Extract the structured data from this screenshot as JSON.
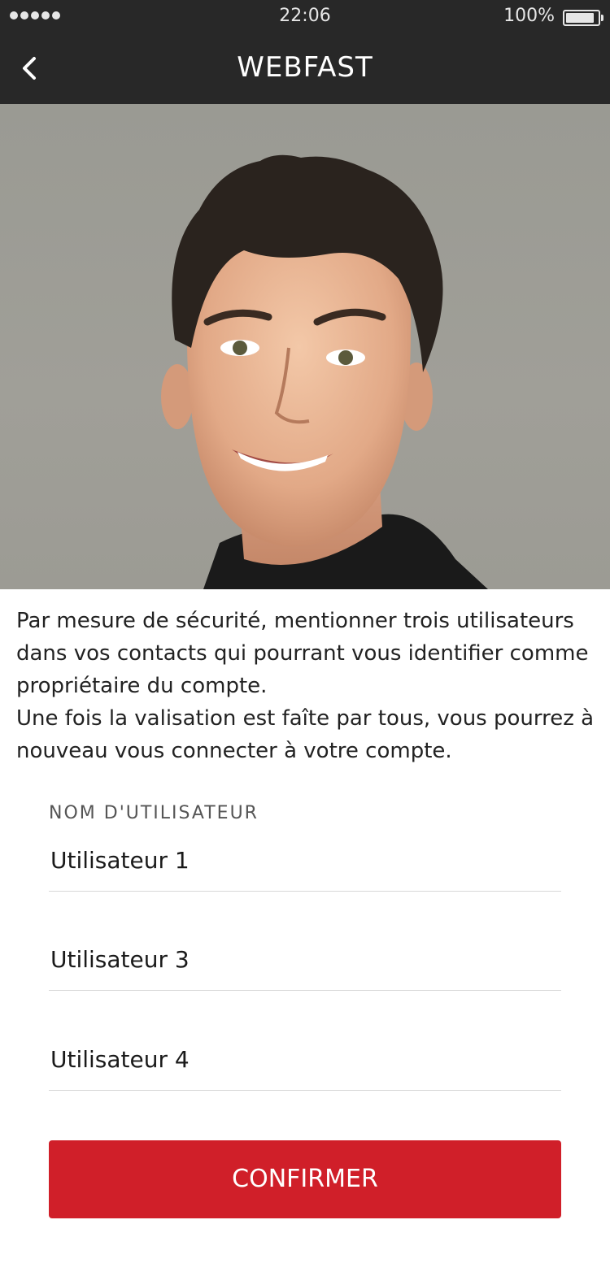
{
  "status_bar": {
    "time": "22:06",
    "battery_text": "100%",
    "battery_level": 1.0,
    "signal_bars": 5,
    "icons": [
      "signal-dots-icon",
      "battery-icon"
    ]
  },
  "nav": {
    "title": "WEBFAST",
    "back_icon": "chevron-left-icon"
  },
  "photo": {
    "icon": "person-portrait-icon"
  },
  "description": {
    "paragraph1": "Par mesure de sécurité, mentionner trois utilisateurs dans vos contacts qui pourrant vous identifier comme propriétaire du compte.",
    "paragraph2": "Une fois la valisation est faîte par tous, vous pourrez à nouveau vous connecter à votre compte."
  },
  "form": {
    "label": "NOM D'UTILISATEUR",
    "fields": [
      {
        "value": "Utilisateur 1"
      },
      {
        "value": "Utilisateur 3"
      },
      {
        "value": "Utilisateur 4"
      }
    ]
  },
  "confirm": {
    "label": "CONFIRMER",
    "color": "#d01f29"
  },
  "colors": {
    "header_bg": "#282828",
    "accent": "#d01f29"
  }
}
